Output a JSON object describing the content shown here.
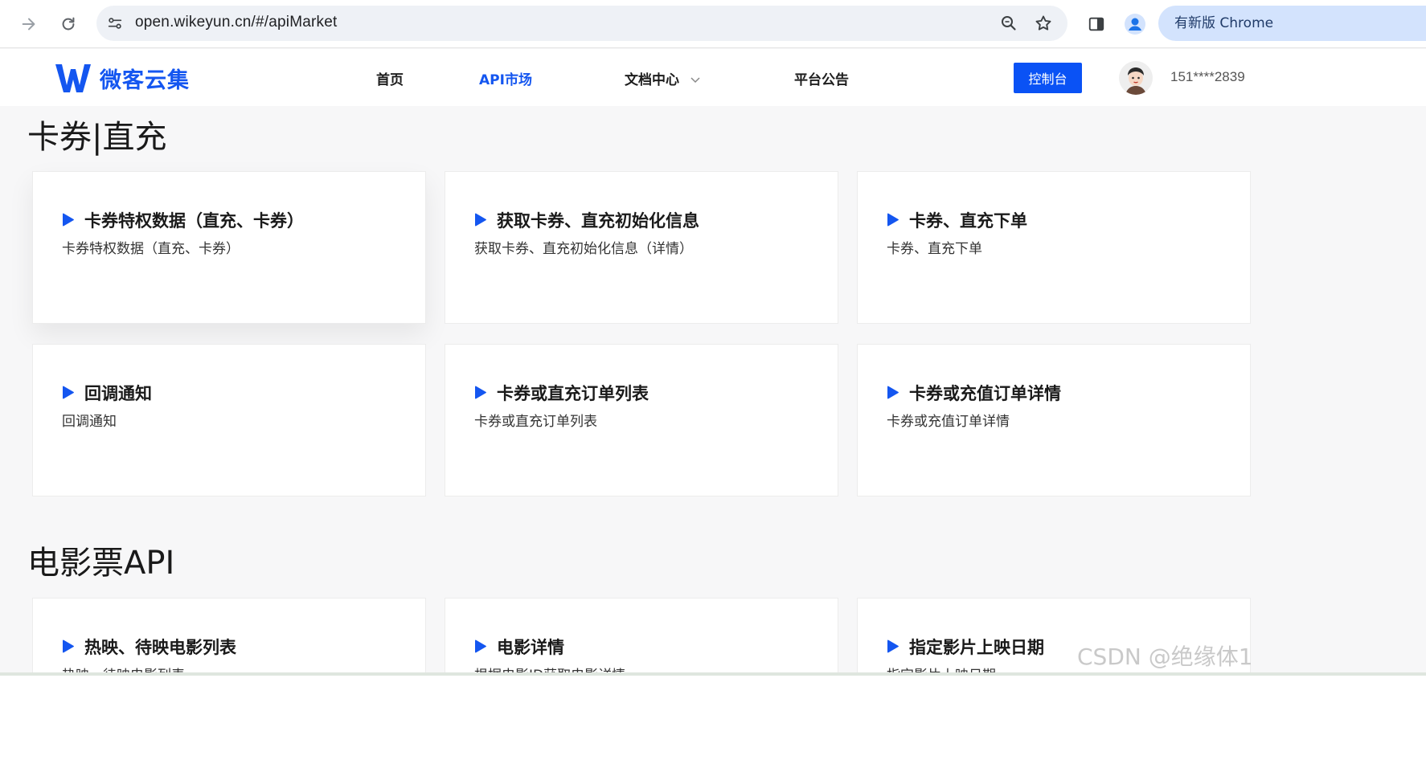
{
  "browser": {
    "url": "open.wikeyun.cn/#/apiMarket",
    "update_label": "有新版 Chrome"
  },
  "header": {
    "logo_text": "微客云集",
    "nav": [
      {
        "label": "首页"
      },
      {
        "label": "API市场",
        "active": true
      },
      {
        "label": "文档中心"
      },
      {
        "label": "平台公告"
      }
    ],
    "console_label": "控制台",
    "user_phone": "151****2839"
  },
  "sections": [
    {
      "title": "卡券|直充",
      "cards": [
        {
          "title": "卡券特权数据（直充、卡券）",
          "desc": "卡券特权数据（直充、卡券）"
        },
        {
          "title": "获取卡券、直充初始化信息",
          "desc": "获取卡券、直充初始化信息（详情）"
        },
        {
          "title": "卡券、直充下单",
          "desc": "卡券、直充下单"
        },
        {
          "title": "回调通知",
          "desc": "回调通知"
        },
        {
          "title": "卡券或直充订单列表",
          "desc": "卡券或直充订单列表"
        },
        {
          "title": "卡券或充值订单详情",
          "desc": "卡券或充值订单详情"
        }
      ]
    },
    {
      "title": "电影票API",
      "cards": [
        {
          "title": "热映、待映电影列表",
          "desc": "热映、待映电影列表"
        },
        {
          "title": "电影详情",
          "desc": "根据电影ID获取电影详情"
        },
        {
          "title": "指定影片上映日期",
          "desc": "指定影片上映日期"
        }
      ]
    }
  ],
  "watermark": "CSDN @绝缘体1",
  "colors": {
    "accent": "#1456f0",
    "console_button": "#0a52f5",
    "page_bg": "#f7f7f8"
  }
}
